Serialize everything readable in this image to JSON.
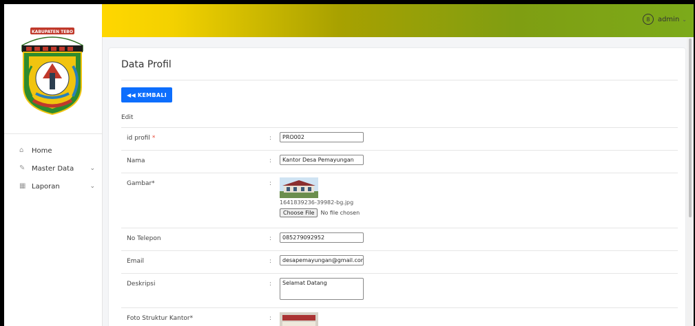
{
  "sidebar": {
    "logo_text": "KABUPATEN TEBO",
    "items": [
      {
        "label": "Home",
        "icon": "home-icon"
      },
      {
        "label": "Master Data",
        "icon": "edit-icon"
      },
      {
        "label": "Laporan",
        "icon": "calendar-icon"
      }
    ]
  },
  "header": {
    "user": "admin"
  },
  "card": {
    "title": "Data Profil",
    "back_label": "KEMBALI",
    "subtitle": "Edit",
    "fields": {
      "id_profil": {
        "label": "id profil",
        "req": "*",
        "value": "PRO002"
      },
      "nama": {
        "label": "Nama",
        "value": "Kantor Desa Pemayungan"
      },
      "gambar": {
        "label": "Gambar*",
        "filename": "1641839236-39982-bg.jpg",
        "file_button": "Choose File",
        "file_status": "No file chosen"
      },
      "telepon": {
        "label": "No Telepon",
        "value": "085279092952"
      },
      "email": {
        "label": "Email",
        "value": "desapemayungan@gmail.com"
      },
      "deskripsi": {
        "label": "Deskripsi",
        "value": "Selamat Datang"
      },
      "struktur": {
        "label": "Foto Struktur Kantor*"
      }
    }
  },
  "colors": {
    "accent": "#0d6efd",
    "required": "#e74c3c"
  }
}
